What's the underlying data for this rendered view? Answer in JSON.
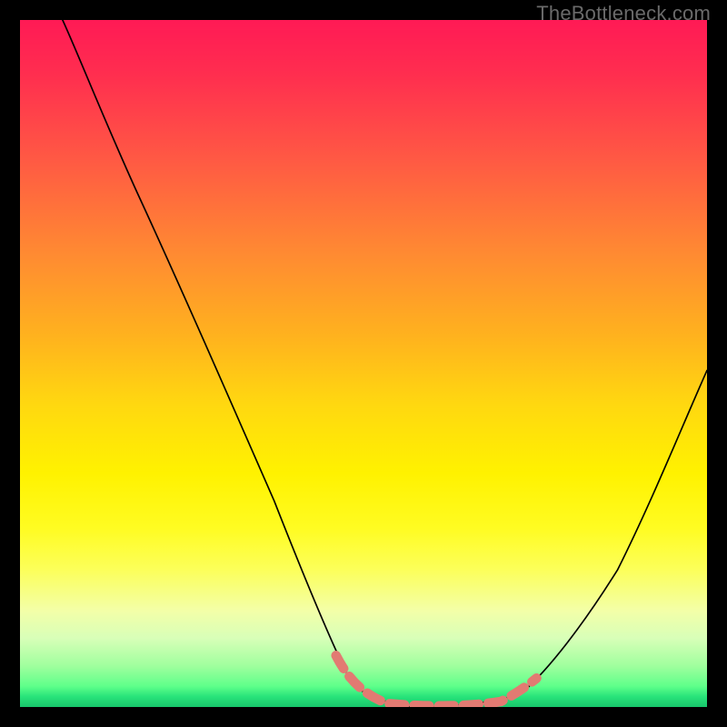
{
  "watermark": "TheBottleneck.com",
  "chart_data": {
    "type": "line",
    "title": "",
    "xlabel": "",
    "ylabel": "",
    "ylim": [
      0,
      100
    ],
    "series": [
      {
        "name": "curve",
        "color": "#000000",
        "points": [
          {
            "x": 0.062,
            "y": 1.0
          },
          {
            "x": 0.085,
            "y": 0.95
          },
          {
            "x": 0.12,
            "y": 0.86
          },
          {
            "x": 0.17,
            "y": 0.75
          },
          {
            "x": 0.23,
            "y": 0.62
          },
          {
            "x": 0.3,
            "y": 0.46
          },
          {
            "x": 0.37,
            "y": 0.3
          },
          {
            "x": 0.425,
            "y": 0.16
          },
          {
            "x": 0.46,
            "y": 0.08
          },
          {
            "x": 0.48,
            "y": 0.04
          },
          {
            "x": 0.495,
            "y": 0.02
          },
          {
            "x": 0.52,
            "y": 0.008
          },
          {
            "x": 0.57,
            "y": 0.0
          },
          {
            "x": 0.64,
            "y": 0.0
          },
          {
            "x": 0.7,
            "y": 0.008
          },
          {
            "x": 0.73,
            "y": 0.02
          },
          {
            "x": 0.77,
            "y": 0.055
          },
          {
            "x": 0.82,
            "y": 0.12
          },
          {
            "x": 0.87,
            "y": 0.2
          },
          {
            "x": 0.92,
            "y": 0.3
          },
          {
            "x": 0.96,
            "y": 0.4
          },
          {
            "x": 1.0,
            "y": 0.49
          }
        ]
      },
      {
        "name": "highlight",
        "color": "#e27a72",
        "points": [
          {
            "x": 0.46,
            "y": 0.075
          },
          {
            "x": 0.478,
            "y": 0.04
          },
          {
            "x": 0.5,
            "y": 0.018
          },
          {
            "x": 0.535,
            "y": 0.005
          },
          {
            "x": 0.59,
            "y": 0.0
          },
          {
            "x": 0.65,
            "y": 0.0
          },
          {
            "x": 0.7,
            "y": 0.008
          },
          {
            "x": 0.728,
            "y": 0.022
          },
          {
            "x": 0.752,
            "y": 0.042
          }
        ]
      }
    ],
    "gradient_stops": [
      {
        "pos": 0.0,
        "color": "#ff1a55"
      },
      {
        "pos": 0.5,
        "color": "#ffd400"
      },
      {
        "pos": 0.8,
        "color": "#fbff50"
      },
      {
        "pos": 1.0,
        "color": "#18c56b"
      }
    ]
  }
}
